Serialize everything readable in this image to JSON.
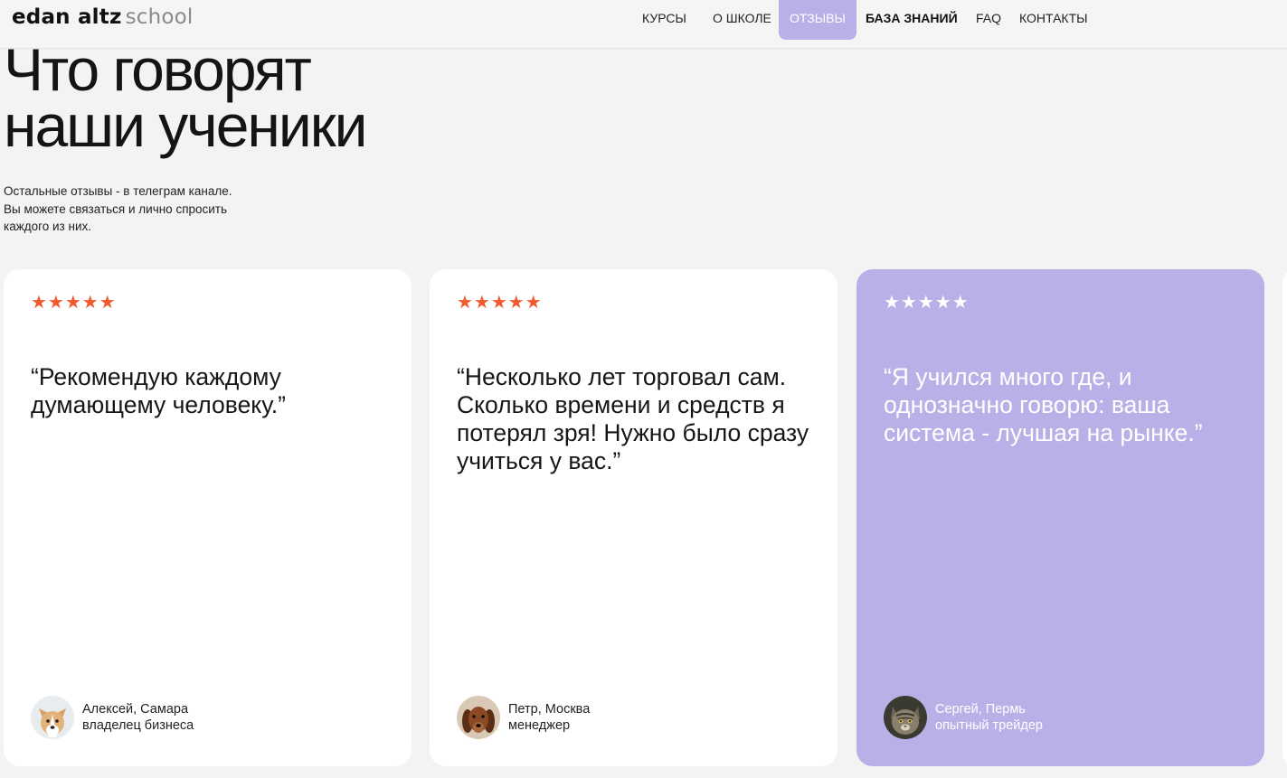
{
  "header": {
    "logo_bold": "edan altz",
    "logo_light": "school",
    "nav": [
      {
        "label": "КУРСЫ"
      },
      {
        "label": "О ШКОЛЕ"
      },
      {
        "label": "ОТЗЫВЫ"
      },
      {
        "label": "БАЗА ЗНАНИЙ"
      },
      {
        "label": "FAQ"
      },
      {
        "label": "КОНТАКТЫ"
      }
    ]
  },
  "hero": {
    "title_line1": "Что говорят",
    "title_line2": "наши ученики",
    "sub_line1": "Остальные отзывы - в телеграм канале.",
    "sub_line2": "Вы можете связаться и лично спросить",
    "sub_line3": "каждого из них."
  },
  "colors": {
    "accent": "#b9b0e8",
    "star": "#f05a2e"
  },
  "reviews": [
    {
      "stars": "★★★★★",
      "rating": 5,
      "quote": "“Рекомендую каждому думающему человеку.”",
      "name": "Алексей, Самара",
      "role": "владелец бизнеса",
      "avatar_icon": "corgi-dog-avatar"
    },
    {
      "stars": "★★★★★",
      "rating": 5,
      "quote": "“Несколько лет торговал сам. Сколько времени и средств я потерял зря! Нужно было сразу учиться у вас.”",
      "name": "Петр, Москва",
      "role": "менеджер",
      "avatar_icon": "brown-dog-avatar"
    },
    {
      "stars": "★★★★★",
      "rating": 5,
      "quote": "“Я учился много где, и однозначно говорю: ваша система - лучшая на рынке.”",
      "name": "Сергей, Пермь",
      "role": "опытный трейдер",
      "avatar_icon": "cat-avatar"
    }
  ]
}
